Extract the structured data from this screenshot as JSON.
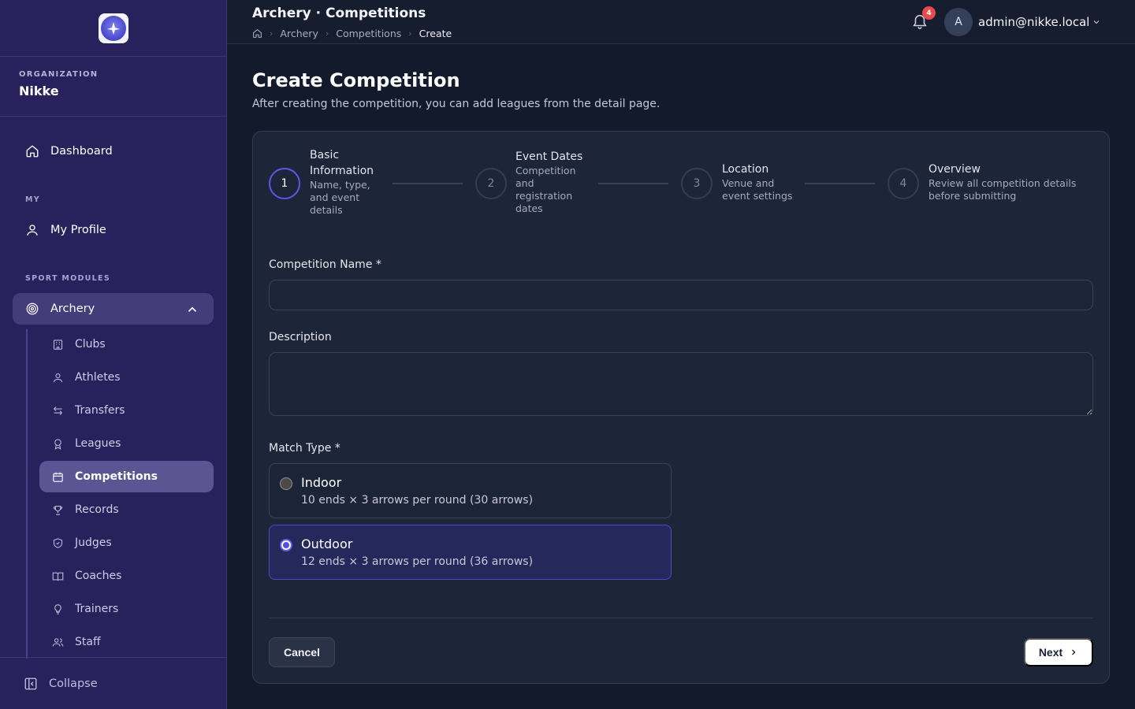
{
  "sidebar": {
    "org_caption": "ORGANIZATION",
    "org_name": "Nikke",
    "dashboard": "Dashboard",
    "my_caption": "MY",
    "my_profile": "My Profile",
    "sport_caption": "SPORT MODULES",
    "archery": "Archery",
    "sub_items": [
      "Clubs",
      "Athletes",
      "Transfers",
      "Leagues",
      "Competitions",
      "Records",
      "Judges",
      "Coaches",
      "Trainers",
      "Staff"
    ],
    "active_item": "Competitions",
    "collapse": "Collapse"
  },
  "topbar": {
    "title": "Archery · Competitions",
    "breadcrumb": [
      "Archery",
      "Competitions",
      "Create"
    ],
    "notification_count": "4",
    "avatar_letter": "A",
    "user_email": "admin@nikke.local"
  },
  "page": {
    "title": "Create Competition",
    "subtitle": "After creating the competition, you can add leagues from the detail page."
  },
  "steps": [
    {
      "number": "1",
      "title": "Basic Information",
      "desc": "Name, type, and event details"
    },
    {
      "number": "2",
      "title": "Event Dates",
      "desc": "Competition and registration dates"
    },
    {
      "number": "3",
      "title": "Location",
      "desc": "Venue and event settings"
    },
    {
      "number": "4",
      "title": "Overview",
      "desc": "Review all competition details before submitting"
    }
  ],
  "current_step": 1,
  "form": {
    "name_label": "Competition Name *",
    "name_value": "",
    "description_label": "Description",
    "description_value": "",
    "match_type_label": "Match Type *",
    "options": [
      {
        "title": "Indoor",
        "desc": "10 ends × 3 arrows per round (30 arrows)",
        "selected": false
      },
      {
        "title": "Outdoor",
        "desc": "12 ends × 3 arrows per round (36 arrows)",
        "selected": true
      }
    ]
  },
  "actions": {
    "cancel": "Cancel",
    "next": "Next"
  },
  "colors": {
    "sidebar_bg": "#29215c",
    "accent": "#5b58e6",
    "page_bg": "#131a2b",
    "badge": "#e94a4a"
  }
}
